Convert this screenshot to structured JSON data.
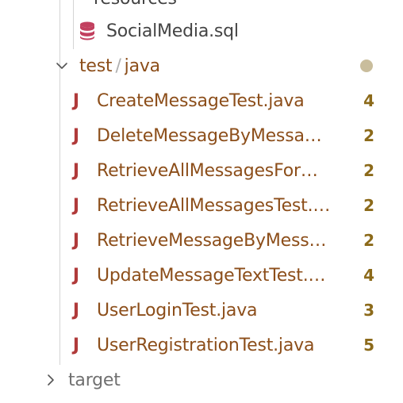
{
  "tree": {
    "top_partial_label": "resources",
    "sql_file": {
      "icon": "database-icon",
      "label": "SocialMedia.sql"
    },
    "test_folder": {
      "label": "test",
      "separator": "/",
      "sub": "java",
      "expanded": true,
      "status": "modified-dot"
    },
    "files": [
      {
        "label": "CreateMessageTest.java",
        "count": "4"
      },
      {
        "label": "DeleteMessageByMessa…",
        "count": "2"
      },
      {
        "label": "RetrieveAllMessagesFor…",
        "count": "2"
      },
      {
        "label": "RetrieveAllMessagesTest.…",
        "count": "2"
      },
      {
        "label": "RetrieveMessageByMess…",
        "count": "2"
      },
      {
        "label": "UpdateMessageTextTest.…",
        "count": "4"
      },
      {
        "label": "UserLoginTest.java",
        "count": "3"
      },
      {
        "label": "UserRegistrationTest.java",
        "count": "5"
      }
    ],
    "target_folder": {
      "label": "target",
      "expanded": false
    },
    "java_icon_glyph": "J"
  },
  "colors": {
    "java_label": "#8c4e1a",
    "java_icon": "#b03a3a",
    "count": "#8c6a1a",
    "modified_dot": "#c9bd9c",
    "guide": "#d4d4d4"
  }
}
